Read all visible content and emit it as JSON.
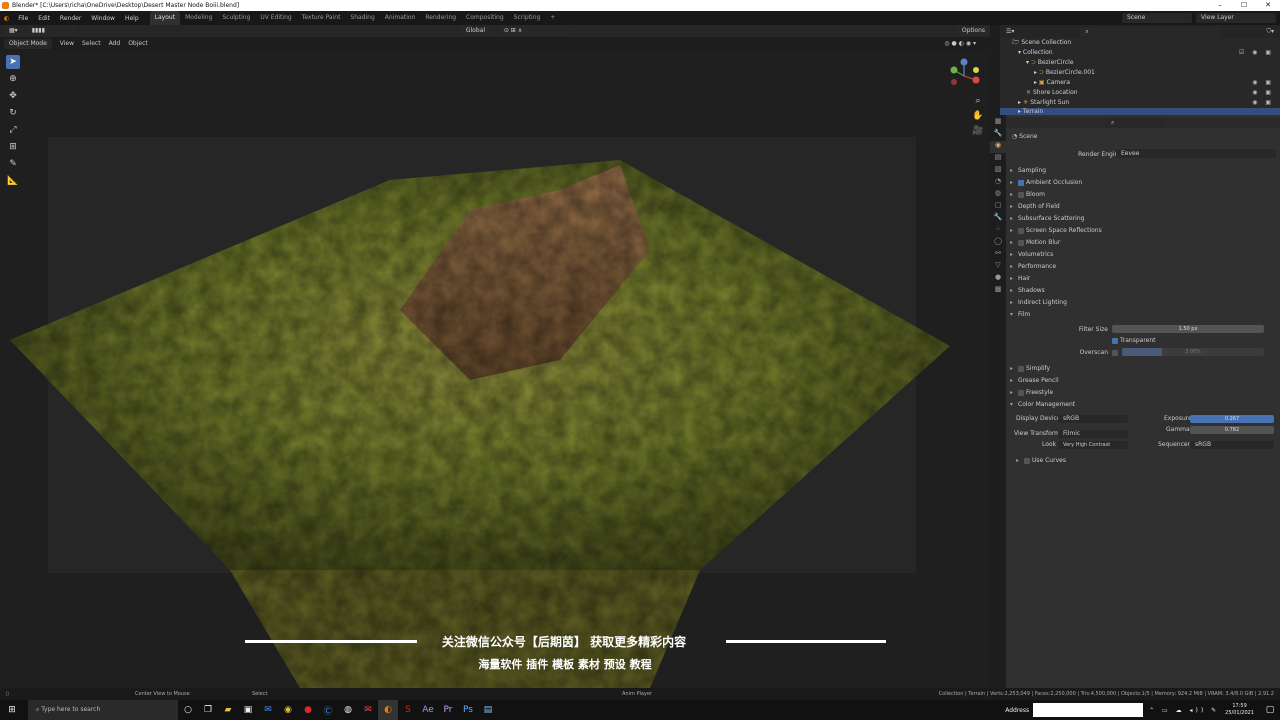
{
  "titlebar": {
    "title": "Blender* [C:\\Users\\richa\\OneDrive\\Desktop\\Desert Master Node Boiii.blend]"
  },
  "menu": [
    "File",
    "Edit",
    "Render",
    "Window",
    "Help"
  ],
  "workspaces": [
    "Layout",
    "Modeling",
    "Sculpting",
    "UV Editing",
    "Texture Paint",
    "Shading",
    "Animation",
    "Rendering",
    "Compositing",
    "Scripting"
  ],
  "scene": "Scene",
  "view_layer": "View Layer",
  "vp": {
    "mode": "Object Mode",
    "menus": [
      "View",
      "Select",
      "Add",
      "Object"
    ],
    "orientation": "Global",
    "options": "Options"
  },
  "outliner": {
    "title": "Scene Collection",
    "rows": [
      "Collection",
      "BezierCircle",
      "BezierCircle.001",
      "Camera",
      "Shore Location",
      "Starlight Sun",
      "Terrain"
    ]
  },
  "props": {
    "scene": "Scene",
    "render_engine_label": "Render Engine",
    "render_engine": "Eevee",
    "panels": [
      "Sampling",
      "Ambient Occlusion",
      "Bloom",
      "Depth of Field",
      "Subsurface Scattering",
      "Screen Space Reflections",
      "Motion Blur",
      "Volumetrics",
      "Performance",
      "Hair",
      "Shadows",
      "Indirect Lighting",
      "Film"
    ],
    "film": {
      "filter_label": "Filter Size",
      "filter": "1.50 px",
      "transparent": "Transparent",
      "overscan": "Overscan",
      "overscan_val": "3.00%"
    },
    "panels2": [
      "Simplify",
      "Grease Pencil",
      "Freestyle",
      "Color Management"
    ],
    "cm": {
      "display_label": "Display Device",
      "display": "sRGB",
      "view_label": "View Transform",
      "view": "Filmic",
      "look_label": "Look",
      "look": "Very High Contrast",
      "exposure_label": "Exposure",
      "exposure": "0.267",
      "gamma_label": "Gamma",
      "gamma": "0.782",
      "seq_label": "Sequencer",
      "seq": "sRGB",
      "curves": "Use Curves"
    }
  },
  "overlay": {
    "line1": "关注微信公众号【后期茵】 获取更多精彩内容",
    "line2": "海量软件 插件 模板 素材 预设 教程"
  },
  "status": {
    "left": "Center View to Mouse",
    "mid": "Select",
    "anim": "Anim Player",
    "right": "Collection | Terrain | Verts:2,253,049 | Faces:2,250,000 | Tris:4,500,000 | Objects:1/5 | Memory: 924.2 MiB | VRAM: 3.4/8.0 GiB | 2.91.2"
  },
  "taskbar": {
    "search": "Type here to search",
    "address": "Address",
    "time": "17:59",
    "date": "25/01/2021"
  }
}
